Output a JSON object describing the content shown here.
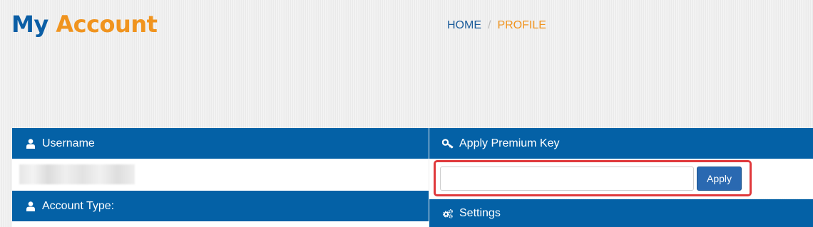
{
  "header": {
    "title_part1": "My",
    "title_part2": "Account"
  },
  "breadcrumb": {
    "home": "HOME",
    "separator": "/",
    "current": "PROFILE"
  },
  "panels": {
    "username": {
      "label": "Username",
      "icon": "user-icon"
    },
    "account_type": {
      "label": "Account Type:",
      "icon": "user-icon"
    },
    "premium_key": {
      "label": "Apply Premium Key",
      "icon": "key-icon",
      "input_value": "",
      "apply_label": "Apply"
    },
    "settings": {
      "label": "Settings",
      "icon": "gears-icon"
    }
  },
  "colors": {
    "brand_blue": "#0461a6",
    "brand_orange": "#f0941f",
    "highlight_red": "#e0393c"
  }
}
